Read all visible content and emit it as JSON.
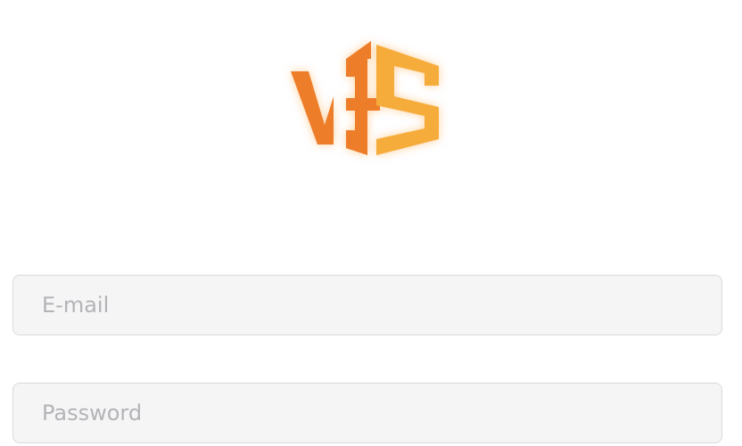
{
  "logo": {
    "icon": "vis-logo-icon",
    "colors": {
      "primary": "#ee7d2c",
      "secondary": "#f6ac3b",
      "glow": "#ffc98a"
    }
  },
  "login": {
    "email": {
      "placeholder": "E-mail",
      "value": ""
    },
    "password": {
      "placeholder": "Password",
      "value": ""
    }
  }
}
